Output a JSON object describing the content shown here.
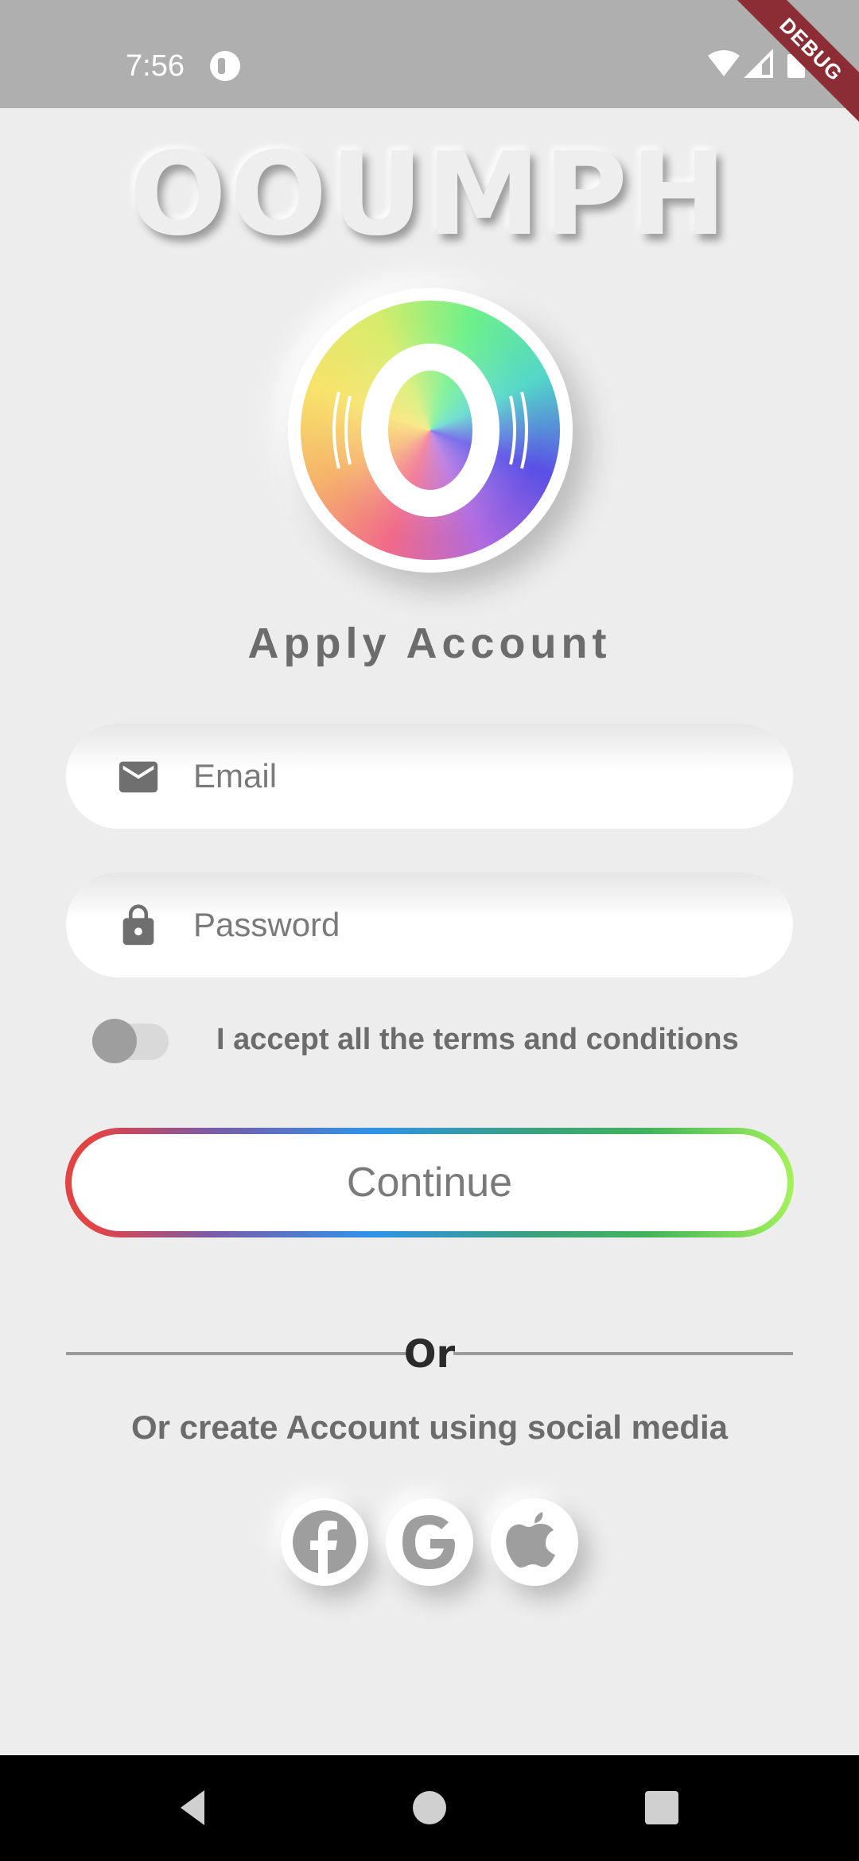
{
  "status_bar": {
    "time": "7:56",
    "icons": [
      "app-notification-icon",
      "wifi-icon",
      "cellular-signal-icon",
      "battery-icon"
    ],
    "debug_banner": "DEBUG"
  },
  "brand": {
    "title": "OOUMPH"
  },
  "logo": {
    "letter": "O"
  },
  "heading": "Apply Account",
  "form": {
    "email": {
      "placeholder": "Email",
      "value": "",
      "icon": "mail-icon"
    },
    "password": {
      "placeholder": "Password",
      "value": "",
      "icon": "lock-icon"
    },
    "terms": {
      "label": "I accept all the terms and conditions",
      "accepted": false
    },
    "continue_label": "Continue"
  },
  "divider": {
    "label": "Or"
  },
  "social": {
    "label": "Or create Account using social media",
    "buttons": [
      {
        "name": "facebook",
        "icon": "facebook-icon"
      },
      {
        "name": "google",
        "icon": "google-icon"
      },
      {
        "name": "apple",
        "icon": "apple-icon"
      }
    ]
  },
  "nav_bar": {
    "buttons": [
      "back-icon",
      "home-icon",
      "recents-icon"
    ]
  },
  "colors": {
    "background": "#ededed",
    "status_bar": "#afafaf",
    "text_gray": "#6c6c6c",
    "gradient_border": [
      "#e24444",
      "#7b5ba6",
      "#2f93e8",
      "#43b35c",
      "#a4f25a"
    ],
    "debug_banner": "#8c2d35"
  }
}
